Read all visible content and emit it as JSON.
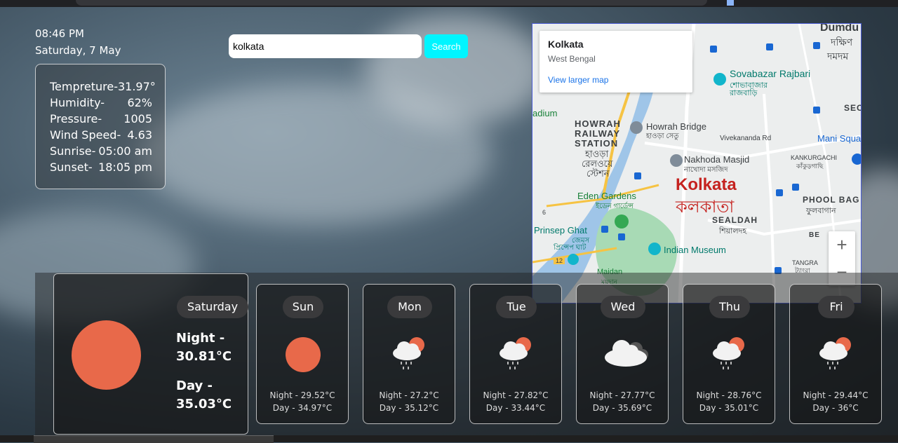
{
  "clock": {
    "time": "08:46 PM",
    "date": "Saturday, 7 May"
  },
  "weather": {
    "rows": [
      {
        "label": "Tempreture-",
        "value": "31.97°"
      },
      {
        "label": "Humidity-",
        "value": "62%"
      },
      {
        "label": "Pressure-",
        "value": "1005"
      },
      {
        "label": "Wind Speed-",
        "value": "4.63"
      },
      {
        "label": "Sunrise-",
        "value": "05:00 am"
      },
      {
        "label": "Sunset-",
        "value": "18:05 pm"
      }
    ]
  },
  "search": {
    "value": "kolkata",
    "button_label": "Search"
  },
  "map": {
    "place_title": "Kolkata",
    "place_region": "West Bengal",
    "larger_map_link": "View larger map",
    "labels": {
      "dumdum": "Dumdu",
      "dakshin": "দক্ষিণ",
      "dumdum_beng": "দমদম",
      "sovabazar": "Sovabazar Rajbari",
      "sovabazar_beng": "শোভাবাজার",
      "sovabazar_beng2": "রাজবাড়ি",
      "adium": "adium",
      "howrah_station1": "HOWRAH",
      "howrah_station2": "RAILWAY",
      "howrah_station3": "STATION",
      "howrah_station_beng1": "হাওড়া",
      "howrah_station_beng2": "রেলওয়ে",
      "howrah_station_beng3": "স্টেশন",
      "howrah_bridge": "Howrah Bridge",
      "howrah_bridge_beng": "হাওড়া সেতু",
      "vivekananda": "Vivekananda Rd",
      "mani_square": "Mani Squa",
      "nakhoda": "Nakhoda Masjid",
      "nakhoda_beng": "নাখোদা মসজিদ",
      "kankurgachi": "KANKURGACHI",
      "kankurgachi_beng": "কাঁকুড়গাছি",
      "kolkata_big": "Kolkata",
      "kolkata_beng": "কলকাতা",
      "eden": "Eden Gardens",
      "eden_beng": "ইডেন গার্ডেন্স",
      "phoolbag": "PHOOL BAG",
      "phoolbag_beng": "ফুলবাগান",
      "sealdah": "SEALDAH",
      "sealdah_beng": "শিয়ালদহ",
      "prinsep": "Prinsep Ghat",
      "prinsep_beng1": "জেমস",
      "prinsep_beng2": "প্রিন্সেপ ঘাট",
      "indian_museum": "Indian Museum",
      "maidan": "Maidan",
      "maidan_beng": "ময়দান",
      "tangra": "TANGRA",
      "tangra_beng": "ট্যাংরা",
      "sec": "SEC",
      "road6": "6",
      "road12": "12",
      "be": "BE"
    },
    "zoom_in": "+",
    "zoom_out": "−"
  },
  "today": {
    "day": "Saturday",
    "night_label": "Night -",
    "night_value": "30.81°C",
    "day_label": "Day -",
    "day_value": "35.03°C"
  },
  "forecast": [
    {
      "day": "Sun",
      "night": "Night - 29.52°C",
      "dayt": "Day - 34.97°C",
      "icon": "sun"
    },
    {
      "day": "Mon",
      "night": "Night - 27.2°C",
      "dayt": "Day - 35.12°C",
      "icon": "rain-sun"
    },
    {
      "day": "Tue",
      "night": "Night - 27.82°C",
      "dayt": "Day - 33.44°C",
      "icon": "rain-sun"
    },
    {
      "day": "Wed",
      "night": "Night - 27.77°C",
      "dayt": "Day - 35.69°C",
      "icon": "cloud"
    },
    {
      "day": "Thu",
      "night": "Night - 28.76°C",
      "dayt": "Day - 35.01°C",
      "icon": "rain-sun"
    },
    {
      "day": "Fri",
      "night": "Night - 29.44°C",
      "dayt": "Day - 36°C",
      "icon": "rain-sun"
    }
  ],
  "colors": {
    "sun": "#e8694a",
    "search_button": "#00f5ff",
    "kolkata_label": "#c5221f"
  }
}
